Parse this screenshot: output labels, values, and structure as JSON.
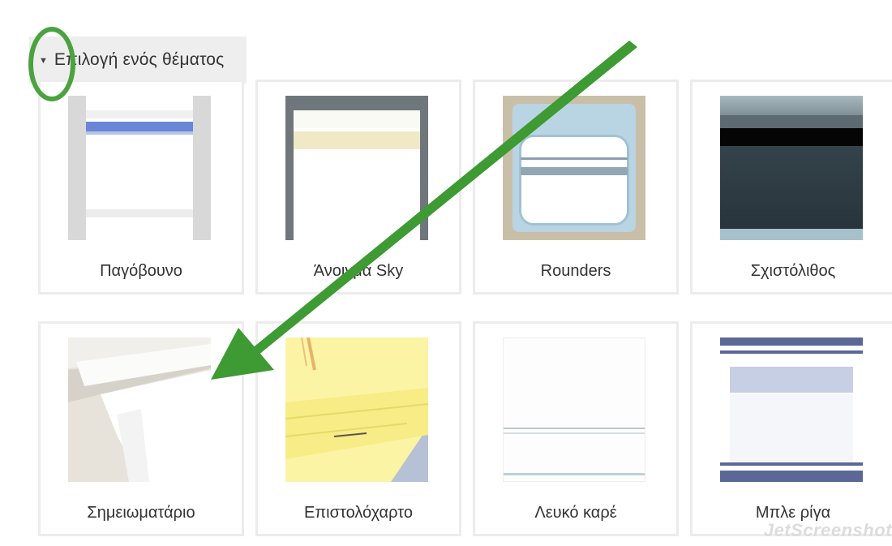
{
  "header": {
    "toggle_label": "Επιλογή ενός θέματος",
    "caret_icon": "triangle-down-icon"
  },
  "themes": [
    {
      "id": "pagovouno",
      "label": "Παγόβουνο"
    },
    {
      "id": "anoigma-sky",
      "label": "Άνοιγμα Sky"
    },
    {
      "id": "rounders",
      "label": "Rounders"
    },
    {
      "id": "sxistolithos",
      "label": "Σχιστόλιθος"
    },
    {
      "id": "simeiomatario",
      "label": "Σημειωματάριο"
    },
    {
      "id": "epistoloxarto",
      "label": "Επιστολόχαρτο"
    },
    {
      "id": "lefko-kare",
      "label": "Λευκό καρέ"
    },
    {
      "id": "mple-riga",
      "label": "Μπλε ρίγα"
    }
  ],
  "annotation": {
    "circle_color": "#4aa33e",
    "arrow_color": "#3e9a33"
  },
  "watermark": {
    "text": "JetScreenshot"
  }
}
